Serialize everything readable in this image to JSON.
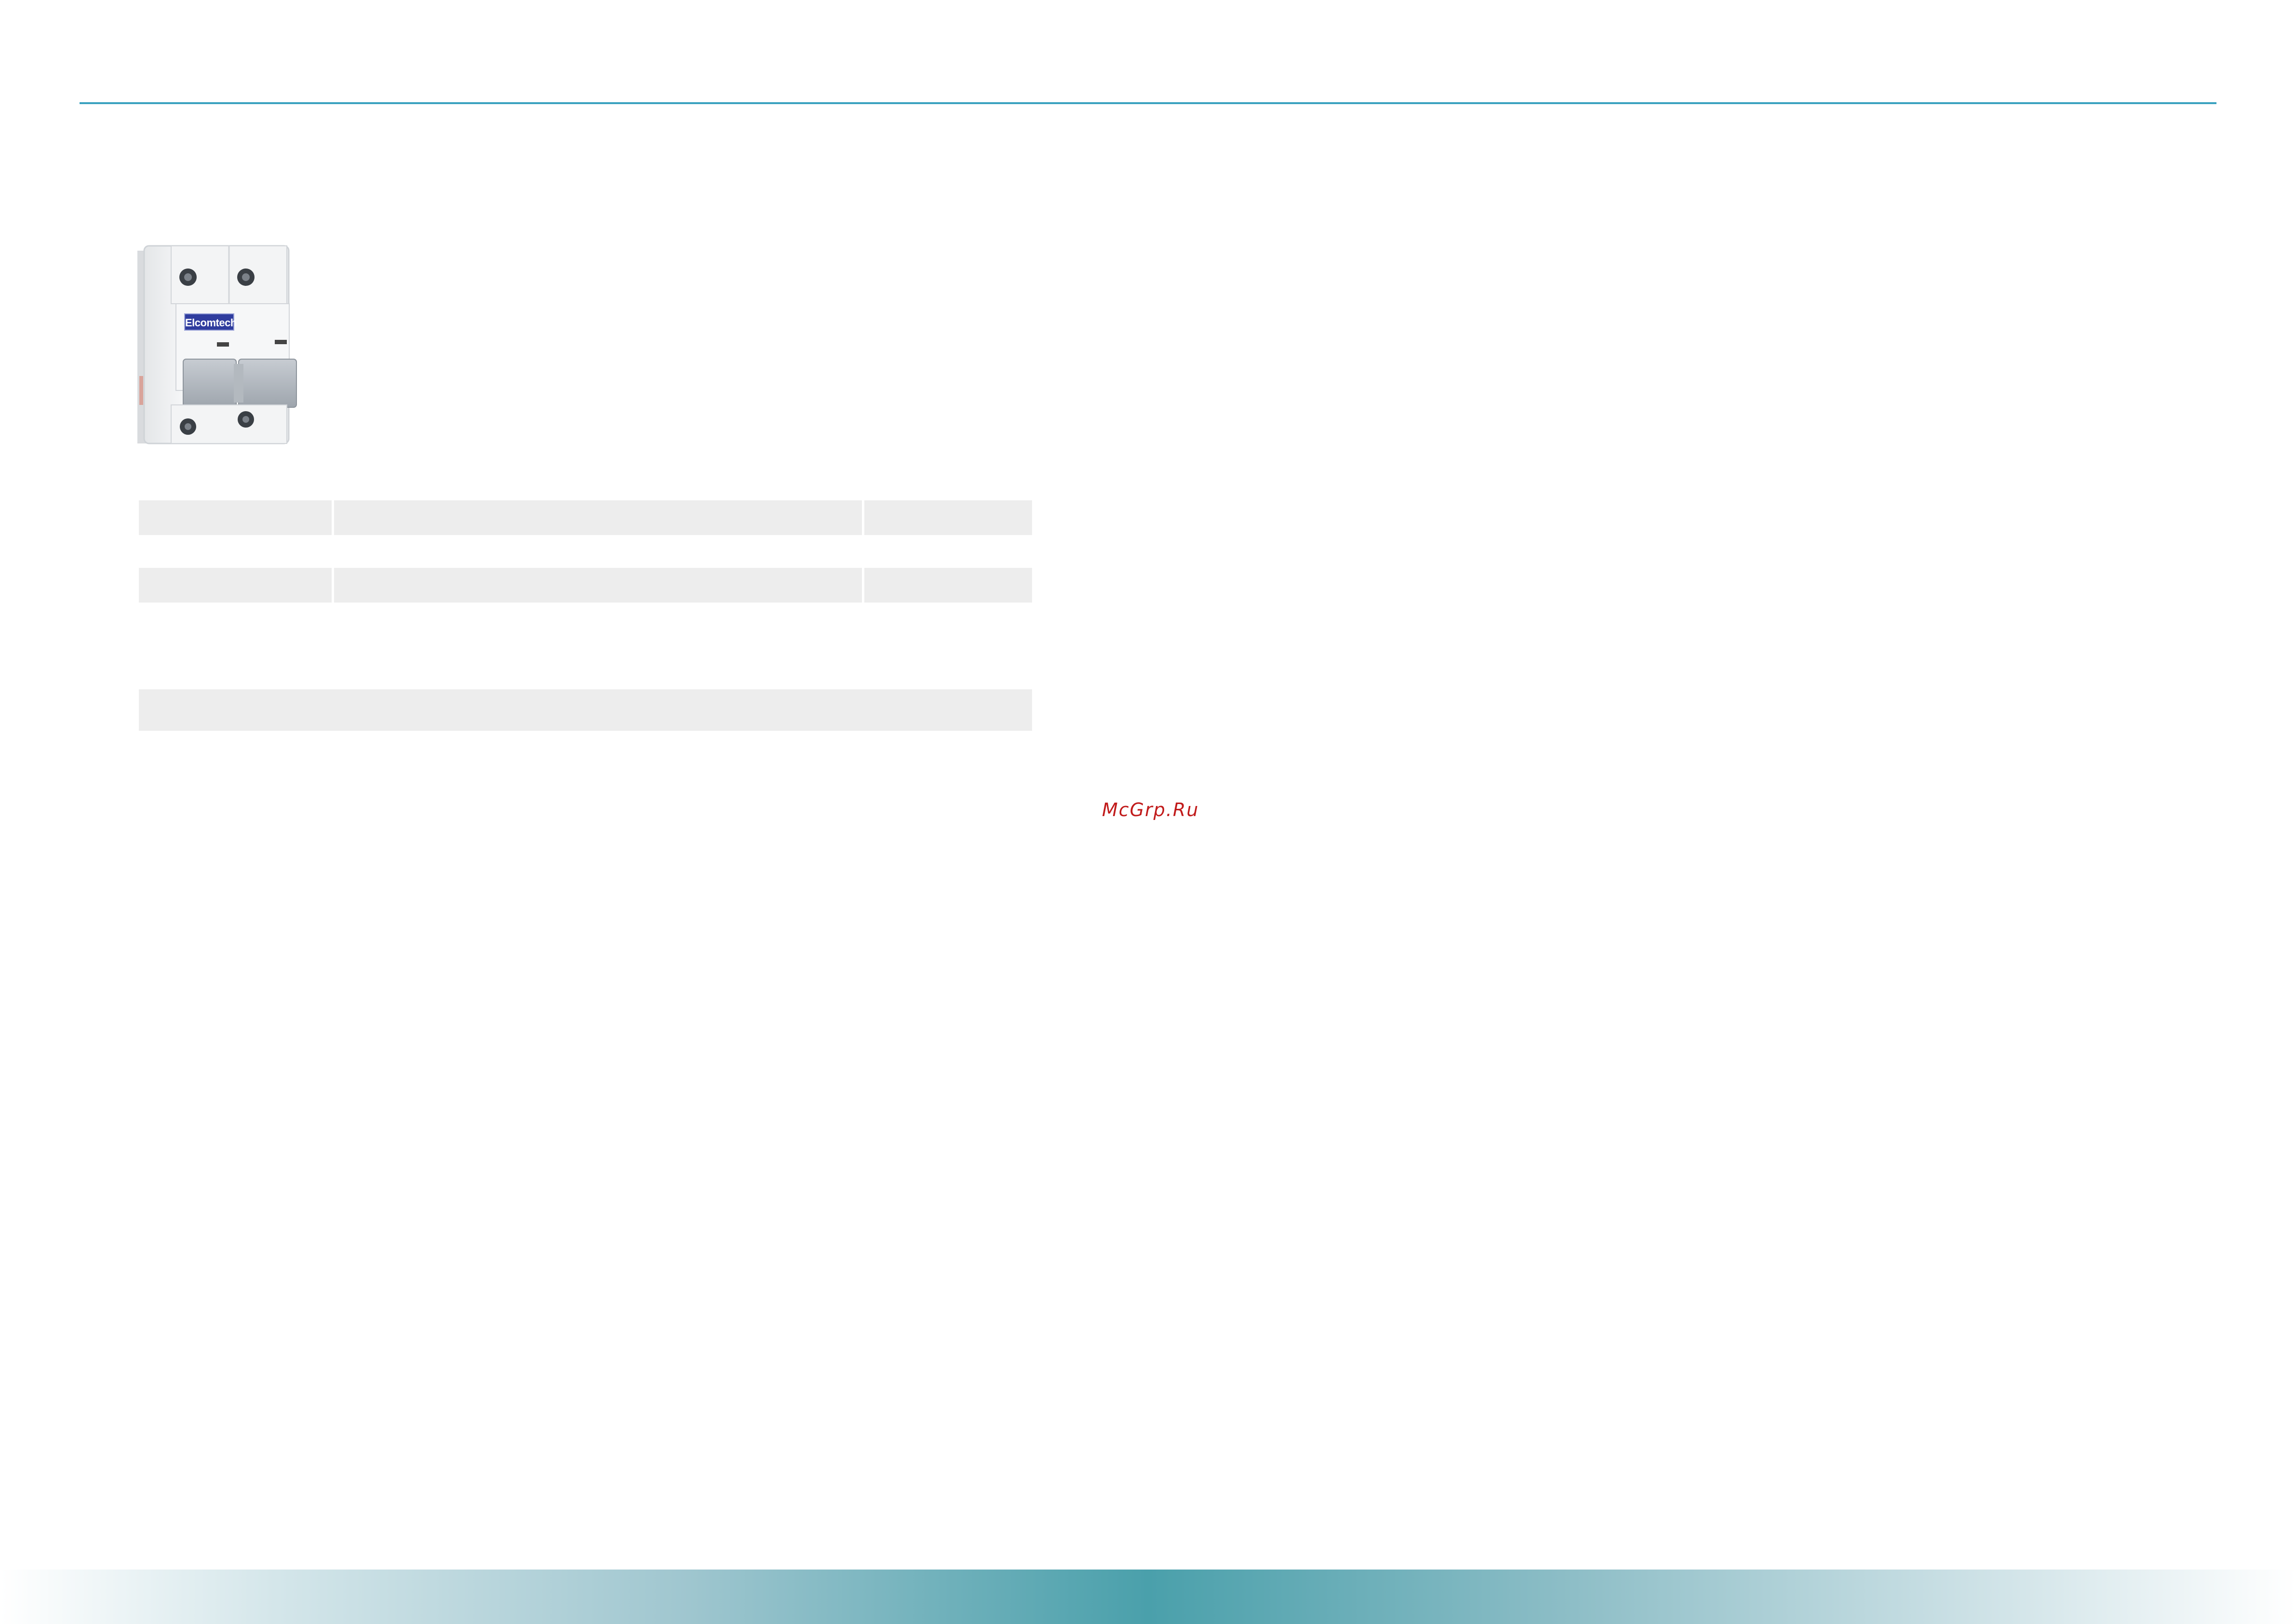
{
  "product": {
    "brand": "Elcomtech"
  },
  "watermark": "McGrp.Ru"
}
